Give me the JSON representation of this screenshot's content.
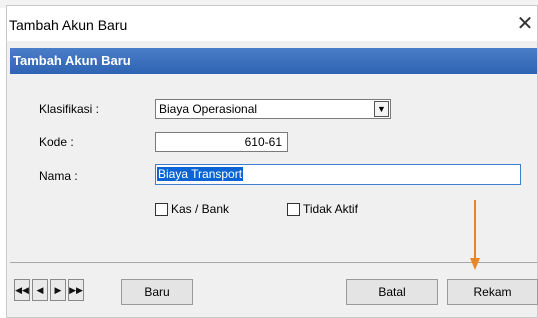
{
  "dialog": {
    "title": "Tambah Akun Baru",
    "header": "Tambah Akun Baru"
  },
  "form": {
    "klasifikasi": {
      "label": "Klasifikasi :",
      "value": "Biaya Operasional"
    },
    "kode": {
      "label": "Kode :",
      "value": "610-61"
    },
    "nama": {
      "label": "Nama :",
      "value": "Biaya Transport"
    },
    "kas_bank": {
      "label": "Kas / Bank",
      "checked": false
    },
    "tidak_aktif": {
      "label": "Tidak Aktif",
      "checked": false
    }
  },
  "buttons": {
    "baru": "Baru",
    "batal": "Batal",
    "rekam": "Rekam"
  },
  "icons": {
    "close": "close-icon",
    "nav_first": "first-record-icon",
    "nav_prev": "previous-record-icon",
    "nav_next": "next-record-icon",
    "nav_last": "last-record-icon",
    "dropdown": "chevron-down-icon"
  },
  "colors": {
    "header_bg": "#2e64b4",
    "selection": "#0a64d6",
    "annotation_arrow": "#e8862a"
  }
}
